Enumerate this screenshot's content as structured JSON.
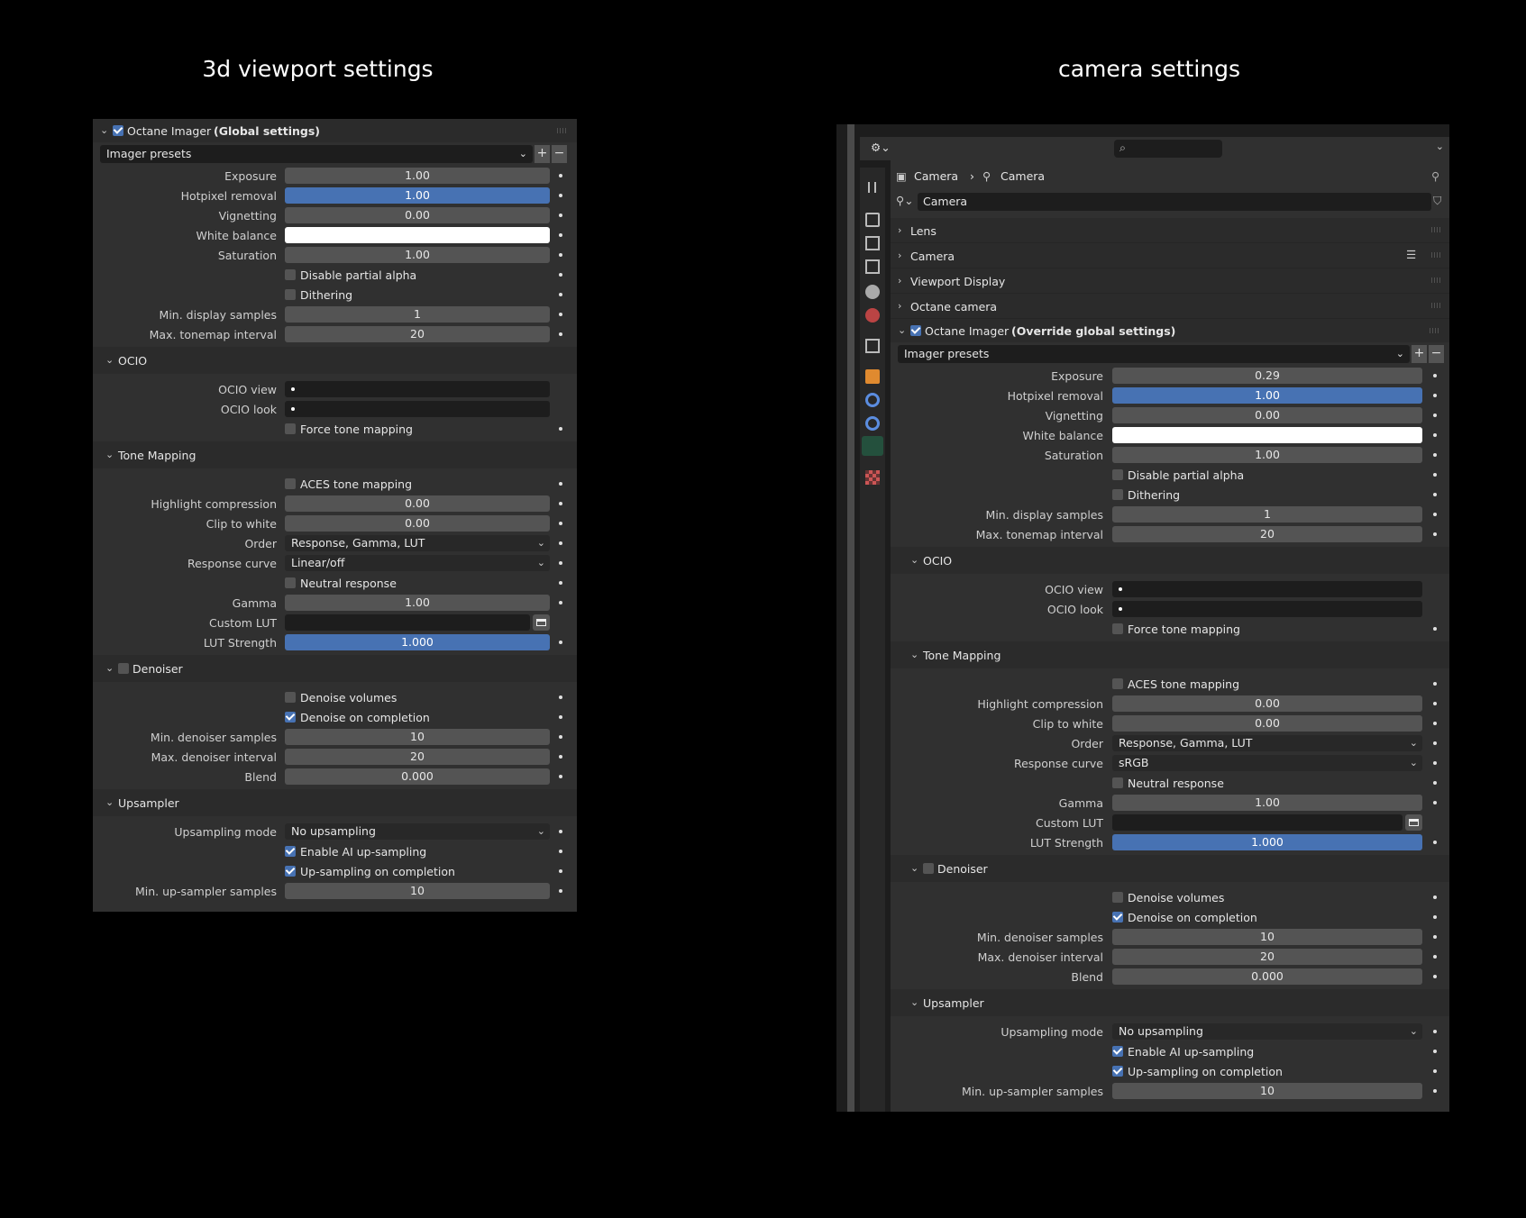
{
  "titles": {
    "left": "3d viewport settings",
    "right": "camera settings"
  },
  "left": {
    "header": {
      "checked": true,
      "name": "Octane Imager",
      "scope": "(Global settings)"
    },
    "presets": "Imager presets",
    "fields": {
      "exposure": {
        "label": "Exposure",
        "value": "1.00"
      },
      "hotpixel": {
        "label": "Hotpixel removal",
        "value": "1.00"
      },
      "vignetting": {
        "label": "Vignetting",
        "value": "0.00"
      },
      "white_balance": {
        "label": "White balance"
      },
      "saturation": {
        "label": "Saturation",
        "value": "1.00"
      },
      "disable_alpha": {
        "label": "Disable partial alpha",
        "checked": false
      },
      "dithering": {
        "label": "Dithering",
        "checked": false
      },
      "min_display": {
        "label": "Min. display samples",
        "value": "1"
      },
      "max_tonemap": {
        "label": "Max. tonemap interval",
        "value": "20"
      }
    },
    "ocio": {
      "title": "OCIO",
      "view_label": "OCIO view",
      "look_label": "OCIO look",
      "force": {
        "label": "Force tone mapping",
        "checked": false
      }
    },
    "tone": {
      "title": "Tone Mapping",
      "aces": {
        "label": "ACES tone mapping",
        "checked": false
      },
      "highlight": {
        "label": "Highlight compression",
        "value": "0.00"
      },
      "clip": {
        "label": "Clip to white",
        "value": "0.00"
      },
      "order": {
        "label": "Order",
        "value": "Response, Gamma, LUT"
      },
      "response": {
        "label": "Response curve",
        "value": "Linear/off"
      },
      "neutral": {
        "label": "Neutral response",
        "checked": false
      },
      "gamma": {
        "label": "Gamma",
        "value": "1.00"
      },
      "lut": {
        "label": "Custom LUT",
        "value": ""
      },
      "lut_strength": {
        "label": "LUT Strength",
        "value": "1.000"
      }
    },
    "denoiser": {
      "title": "Denoiser",
      "enabled": false,
      "volumes": {
        "label": "Denoise volumes",
        "checked": false
      },
      "on_completion": {
        "label": "Denoise on completion",
        "checked": true
      },
      "min_samples": {
        "label": "Min. denoiser samples",
        "value": "10"
      },
      "max_interval": {
        "label": "Max. denoiser interval",
        "value": "20"
      },
      "blend": {
        "label": "Blend",
        "value": "0.000"
      }
    },
    "upsampler": {
      "title": "Upsampler",
      "mode": {
        "label": "Upsampling mode",
        "value": "No upsampling"
      },
      "ai": {
        "label": "Enable AI up-sampling",
        "checked": true
      },
      "on_completion": {
        "label": "Up-sampling on completion",
        "checked": true
      },
      "min_samples": {
        "label": "Min. up-sampler samples",
        "value": "10"
      }
    }
  },
  "right": {
    "breadcrumb": {
      "object": "Camera",
      "data": "Camera"
    },
    "datablock_name": "Camera",
    "collapsed": [
      "Lens",
      "Camera",
      "Viewport Display",
      "Octane camera"
    ],
    "header": {
      "checked": true,
      "name": "Octane Imager",
      "scope": "(Override global settings)"
    },
    "presets": "Imager presets",
    "fields": {
      "exposure": {
        "label": "Exposure",
        "value": "0.29"
      },
      "hotpixel": {
        "label": "Hotpixel removal",
        "value": "1.00"
      },
      "vignetting": {
        "label": "Vignetting",
        "value": "0.00"
      },
      "white_balance": {
        "label": "White balance"
      },
      "saturation": {
        "label": "Saturation",
        "value": "1.00"
      },
      "disable_alpha": {
        "label": "Disable partial alpha",
        "checked": false
      },
      "dithering": {
        "label": "Dithering",
        "checked": false
      },
      "min_display": {
        "label": "Min. display samples",
        "value": "1"
      },
      "max_tonemap": {
        "label": "Max. tonemap interval",
        "value": "20"
      }
    },
    "ocio": {
      "title": "OCIO",
      "view_label": "OCIO view",
      "look_label": "OCIO look",
      "force": {
        "label": "Force tone mapping",
        "checked": false
      }
    },
    "tone": {
      "title": "Tone Mapping",
      "aces": {
        "label": "ACES tone mapping",
        "checked": false
      },
      "highlight": {
        "label": "Highlight compression",
        "value": "0.00"
      },
      "clip": {
        "label": "Clip to white",
        "value": "0.00"
      },
      "order": {
        "label": "Order",
        "value": "Response, Gamma, LUT"
      },
      "response": {
        "label": "Response curve",
        "value": "sRGB"
      },
      "neutral": {
        "label": "Neutral response",
        "checked": false
      },
      "gamma": {
        "label": "Gamma",
        "value": "1.00"
      },
      "lut": {
        "label": "Custom LUT",
        "value": ""
      },
      "lut_strength": {
        "label": "LUT Strength",
        "value": "1.000"
      }
    },
    "denoiser": {
      "title": "Denoiser",
      "enabled": false,
      "volumes": {
        "label": "Denoise volumes",
        "checked": false
      },
      "on_completion": {
        "label": "Denoise on completion",
        "checked": true
      },
      "min_samples": {
        "label": "Min. denoiser samples",
        "value": "10"
      },
      "max_interval": {
        "label": "Max. denoiser interval",
        "value": "20"
      },
      "blend": {
        "label": "Blend",
        "value": "0.000"
      }
    },
    "upsampler": {
      "title": "Upsampler",
      "mode": {
        "label": "Upsampling mode",
        "value": "No upsampling"
      },
      "ai": {
        "label": "Enable AI up-sampling",
        "checked": true
      },
      "on_completion": {
        "label": "Up-sampling on completion",
        "checked": true
      },
      "min_samples": {
        "label": "Min. up-sampler samples",
        "value": "10"
      }
    }
  },
  "colors": {
    "accent": "#4772b3",
    "panel": "#303030",
    "field": "#545454"
  }
}
